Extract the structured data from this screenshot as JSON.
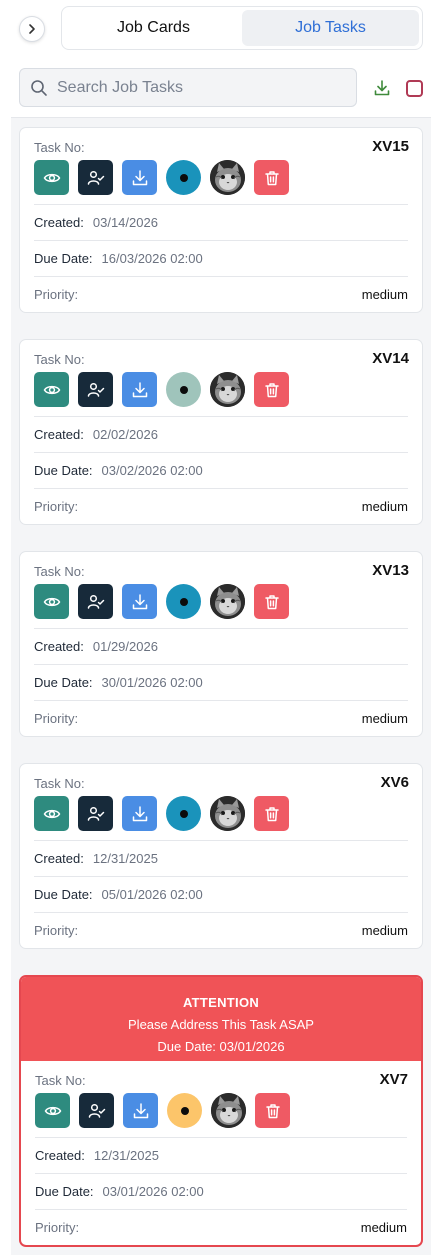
{
  "tabs": [
    {
      "label": "Job Cards"
    },
    {
      "label": "Job Tasks"
    }
  ],
  "search": {
    "placeholder": "Search Job Tasks",
    "value": ""
  },
  "labels": {
    "task_no": "Task No:",
    "created": "Created:",
    "due_date": "Due Date:",
    "priority": "Priority:"
  },
  "alert": {
    "title": "ATTENTION",
    "message": "Please Address This Task ASAP",
    "due": "Due Date: 03/01/2026"
  },
  "colors": {
    "status_blue": "#1a93bb",
    "status_grey": "#9fc4bb",
    "status_yellow": "#fcc56a",
    "alert_red": "#f05357"
  },
  "tasks": [
    {
      "task_no": "XV15",
      "created": "03/14/2026",
      "due": "16/03/2026 02:00",
      "priority": "medium",
      "status_color": "#1a93bb"
    },
    {
      "task_no": "XV14",
      "created": "02/02/2026",
      "due": "03/02/2026 02:00",
      "priority": "medium",
      "status_color": "#9fc4bb"
    },
    {
      "task_no": "XV13",
      "created": "01/29/2026",
      "due": "30/01/2026 02:00",
      "priority": "medium",
      "status_color": "#1a93bb"
    },
    {
      "task_no": "XV6",
      "created": "12/31/2025",
      "due": "05/01/2026 02:00",
      "priority": "medium",
      "status_color": "#1a93bb"
    },
    {
      "task_no": "XV7",
      "created": "12/31/2025",
      "due": "03/01/2026 02:00",
      "priority": "medium",
      "status_color": "#fcc56a"
    }
  ]
}
